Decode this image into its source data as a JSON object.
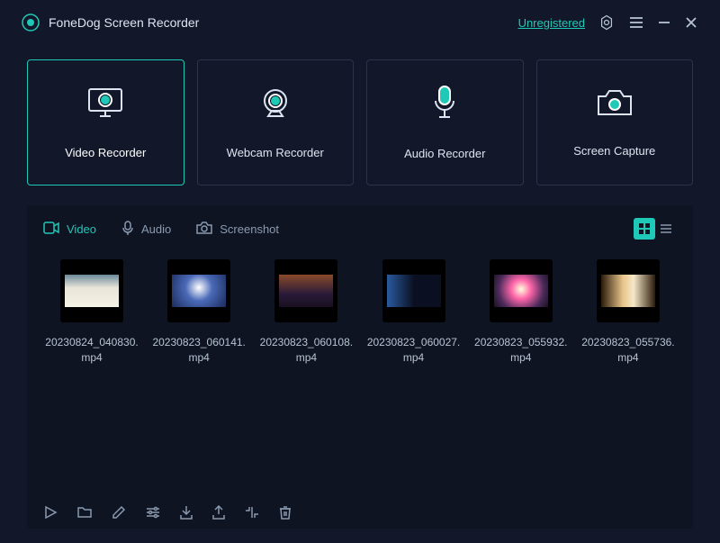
{
  "titlebar": {
    "appName": "FoneDog Screen Recorder",
    "unregistered": "Unregistered"
  },
  "modes": {
    "video": "Video Recorder",
    "webcam": "Webcam Recorder",
    "audio": "Audio Recorder",
    "capture": "Screen Capture"
  },
  "tabs": {
    "video": "Video",
    "audio": "Audio",
    "screenshot": "Screenshot"
  },
  "files": [
    {
      "name": "20230824_040830.mp4"
    },
    {
      "name": "20230823_060141.mp4"
    },
    {
      "name": "20230823_060108.mp4"
    },
    {
      "name": "20230823_060027.mp4"
    },
    {
      "name": "20230823_055932.mp4"
    },
    {
      "name": "20230823_055736.mp4"
    }
  ]
}
